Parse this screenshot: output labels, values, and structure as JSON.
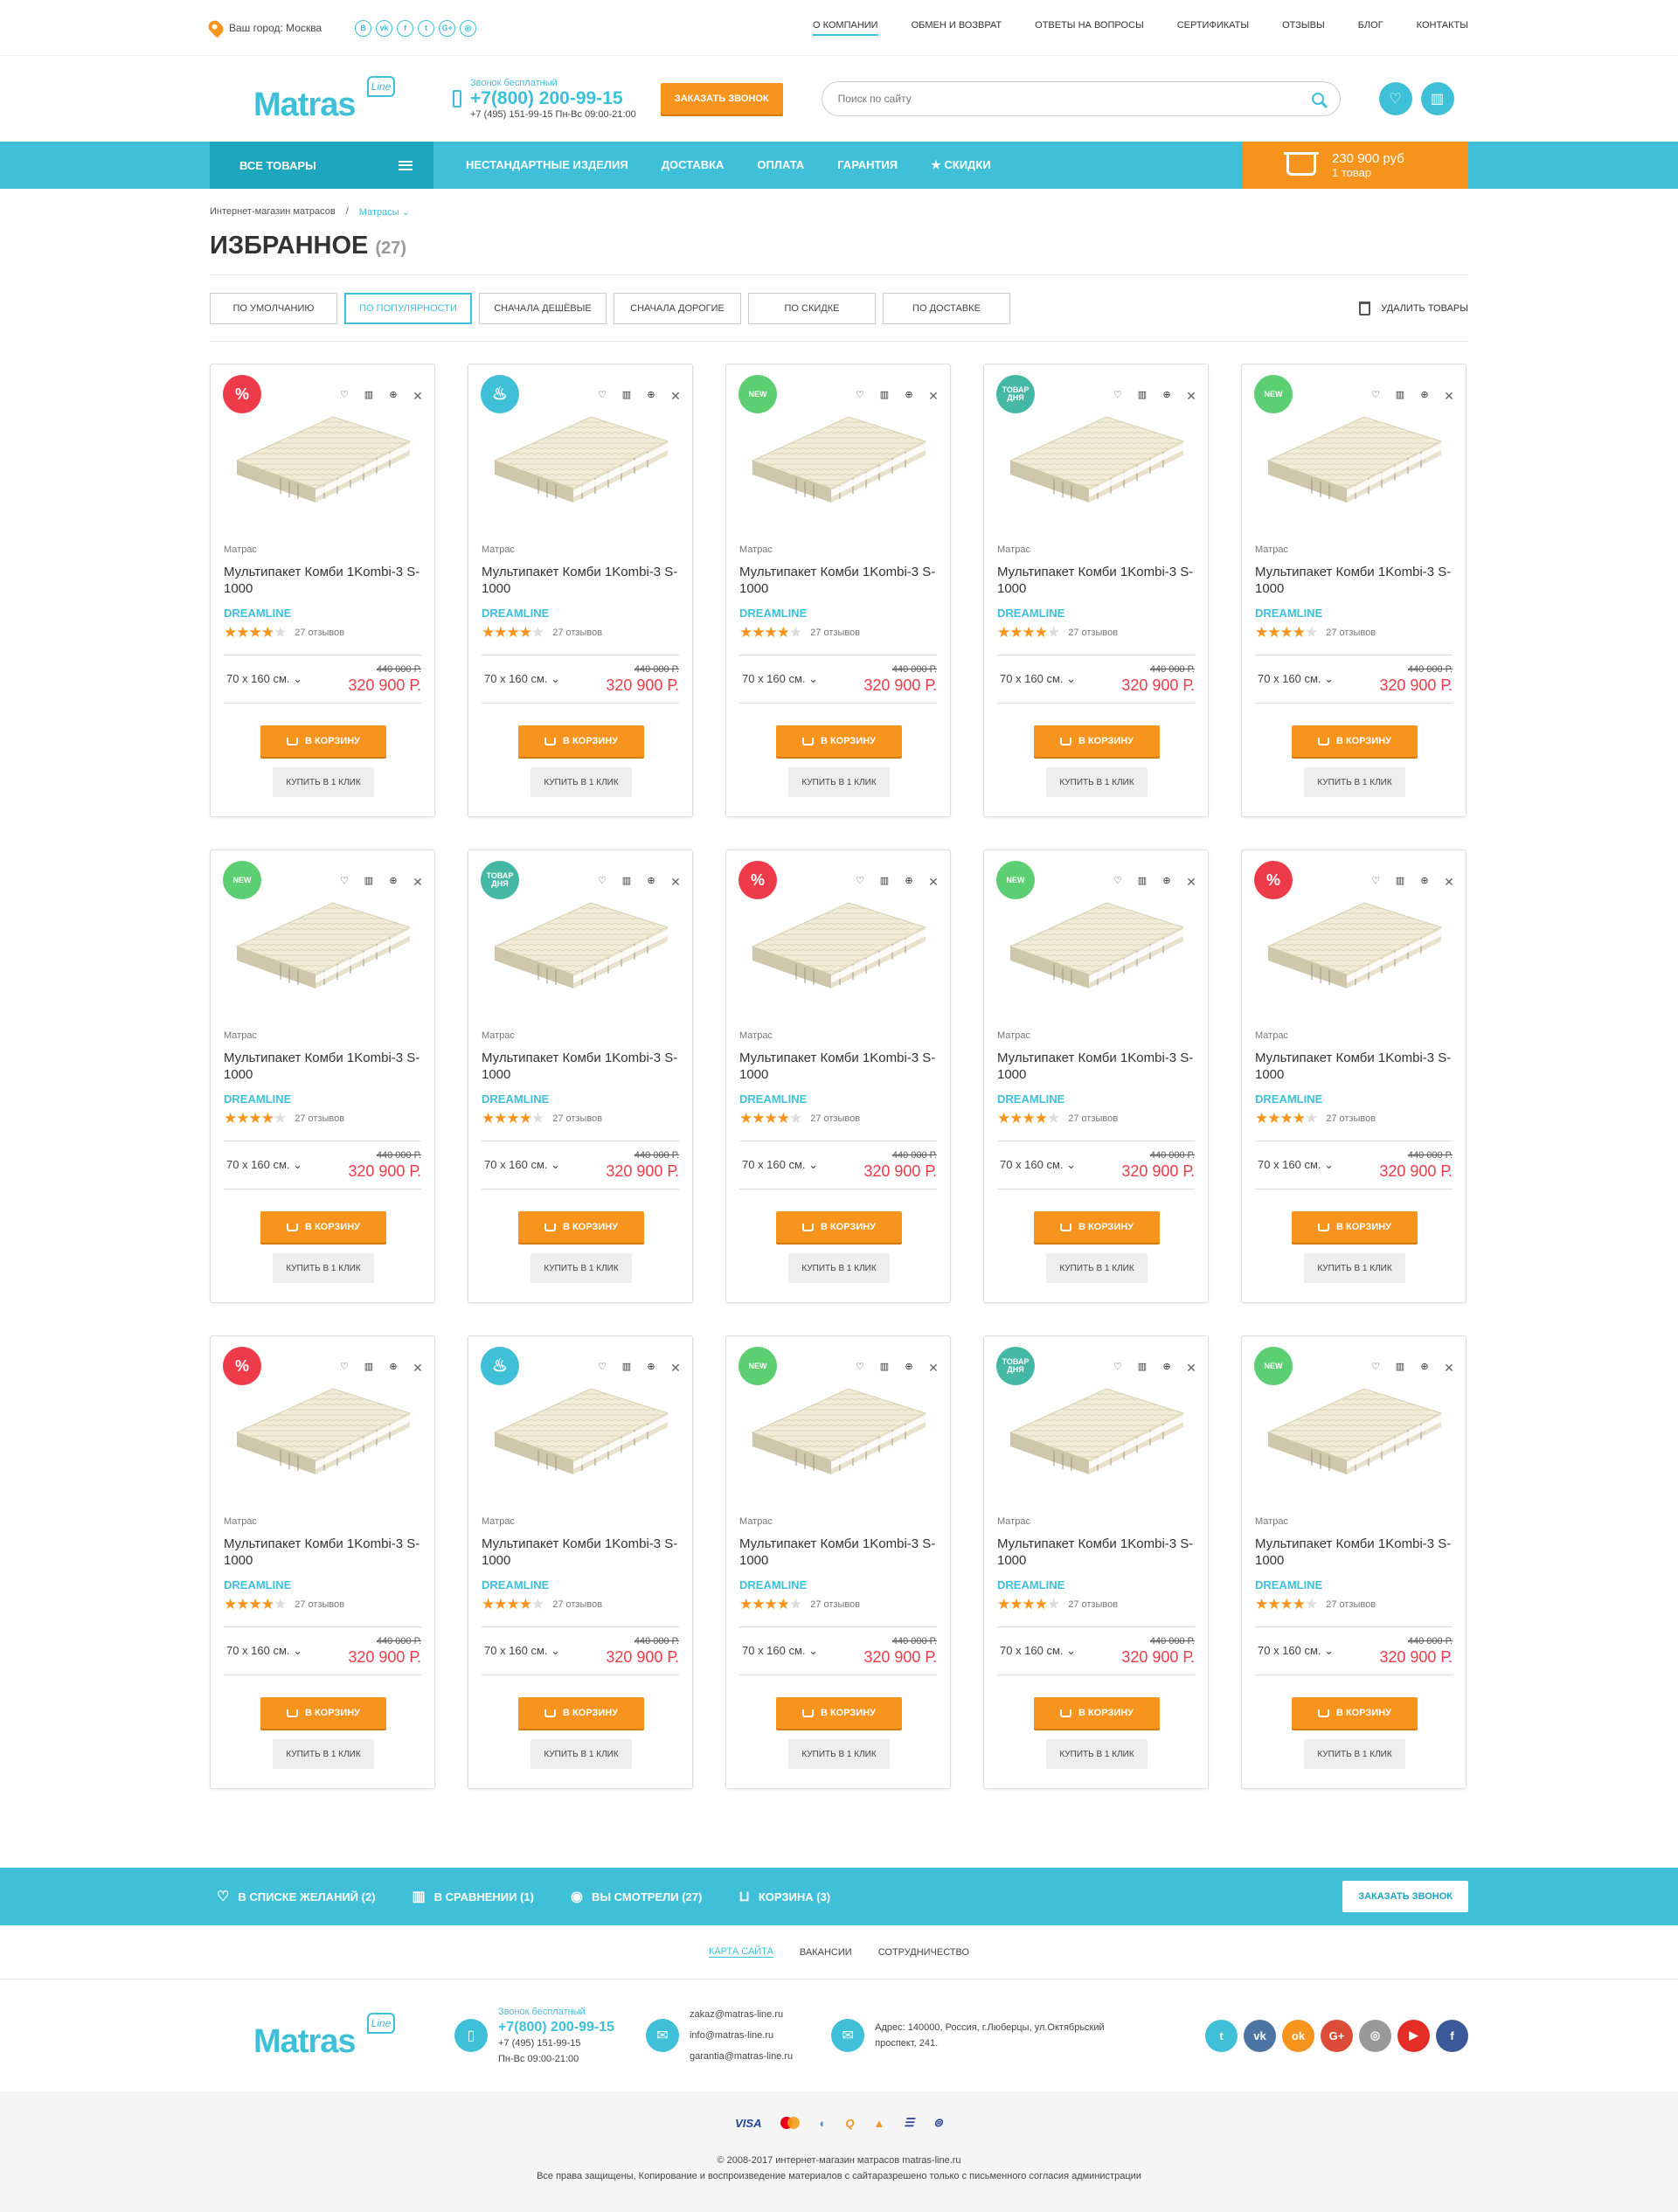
{
  "topbar": {
    "city": "Ваш город: Москва",
    "socials": [
      "В",
      "vk",
      "f",
      "t",
      "G+",
      "◎"
    ],
    "nav": [
      "О КОМПАНИИ",
      "ОБМЕН И ВОЗВРАТ",
      "ОТВЕТЫ НА ВОПРОСЫ",
      "СЕРТИФИКАТЫ",
      "ОТЗЫВЫ",
      "БЛОГ",
      "КОНТАКТЫ"
    ]
  },
  "header": {
    "logo": "Matras",
    "logo_tag": "Line",
    "phone_note": "Звонок бесплатный",
    "phone": "+7(800) 200-99-15",
    "phone_sub": "+7 (495) 151-99-15  Пн-Вс 09:00-21:00",
    "callback": "ЗАКАЗАТЬ ЗВОНОК",
    "search_placeholder": "Поиск по сайту"
  },
  "mainnav": {
    "all": "ВСЕ ТОВАРЫ",
    "links": [
      "НЕСТАНДАРТНЫЕ ИЗДЕЛИЯ",
      "ДОСТАВКА",
      "ОПЛАТА",
      "ГАРАНТИЯ",
      "★ СКИДКИ"
    ],
    "cart_sum": "230 900 руб",
    "cart_count": "1 товар"
  },
  "breadcrumb": {
    "home": "Интернет-магазин матрасов",
    "sep": "/",
    "current": "Матрасы ⌄"
  },
  "title": {
    "text": "ИЗБРАННОЕ",
    "count": "(27)"
  },
  "sort": {
    "options": [
      "ПО УМОЛЧАНИЮ",
      "ПО ПОПУЛЯРНОСТИ",
      "СНАЧАЛА ДЕШЁВЫЕ",
      "СНАЧАЛА ДОРОГИЕ",
      "ПО СКИДКЕ",
      "ПО ДОСТАВКЕ"
    ],
    "delete": "УДАЛИТЬ ТОВАРЫ"
  },
  "colors": {
    "accent": "#3fc0d8",
    "orange": "#f7941d",
    "red": "#ed3b4a",
    "green": "#5ccf73",
    "teal": "#45b8a5"
  },
  "product": {
    "category": "Матрас",
    "name": "Мультипакет Комби 1Kombi-3 S-1000",
    "brand": "DREAMLINE",
    "reviews": "27 отзывов",
    "rating": 4,
    "size": "70 x 160 см. ⌄",
    "old_price": "440 000 Р.",
    "price": "320 900 Р.",
    "cart_btn": "В КОРЗИНУ",
    "oneclick": "КУПИТЬ В 1 КЛИК"
  },
  "badges": {
    "sale": "%",
    "new": "NEW",
    "day": "ТОВАР ДНЯ",
    "hot": "♨"
  },
  "cards": [
    "sale",
    "hot",
    "new",
    "day",
    "new",
    "new",
    "day",
    "sale",
    "new",
    "sale",
    "sale",
    "hot",
    "new",
    "day",
    "new"
  ],
  "footbar": {
    "wish": "В СПИСКЕ ЖЕЛАНИЙ (2)",
    "compare": "В СРАВНЕНИИ (1)",
    "viewed": "ВЫ СМОТРЕЛИ (27)",
    "basket": "КОРЗИНА (3)",
    "callback": "ЗАКАЗАТЬ ЗВОНОК"
  },
  "footlinks": [
    "КАРТА САЙТА",
    "ВАКАНСИИ",
    "СОТРУДНИЧЕСТВО"
  ],
  "footinfo": {
    "phone_note": "Звонок бесплатный",
    "phone": "+7(800) 200-99-15",
    "phone2": "+7 (495) 151-99-15",
    "hours": "Пн-Вс 09:00-21:00",
    "email1": "zakaz@matras-line.ru",
    "email2": "info@matras-line.ru",
    "email3": "garantia@matras-line.ru",
    "address1": "Адрес: 140000, Россия, г.Люберцы, ул.Октябрьский",
    "address2": "проспект, 241."
  },
  "pay": [
    "VISA",
    "MC",
    "◐",
    "Q",
    "▲",
    "☰",
    "⊜"
  ],
  "copyright": "© 2008-2017 интернет-магазин матрасов matras-line.ru",
  "rights": "Все права защищены, Копирование и воспроизведение материалов с сайтаразрешено только с письменного согласия администрации"
}
